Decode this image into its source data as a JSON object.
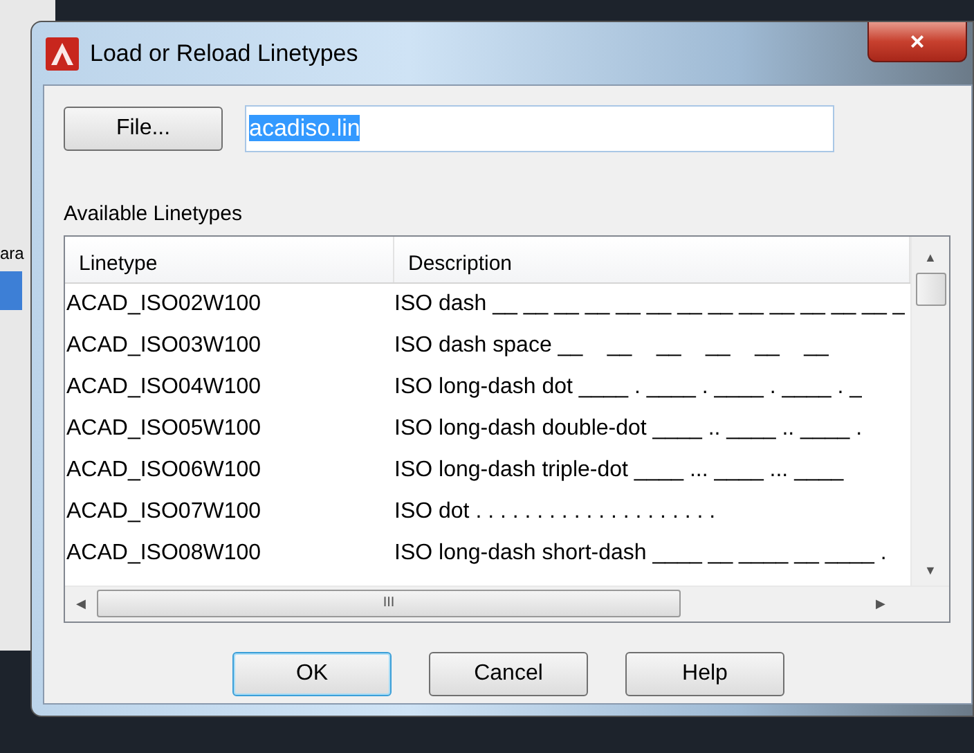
{
  "background": {
    "fragment": "ara"
  },
  "window": {
    "title": "Load or Reload Linetypes",
    "close": "×"
  },
  "file_button": "File...",
  "file_field": {
    "value": "acadiso.lin",
    "text_selected": true
  },
  "list_label": "Available Linetypes",
  "table": {
    "columns": [
      "Linetype",
      "Description"
    ],
    "rows": [
      {
        "linetype": "ACAD_ISO02W100",
        "description": "ISO dash __ __ __ __ __ __ __ __ __ __ __ __ __ _"
      },
      {
        "linetype": "ACAD_ISO03W100",
        "description": "ISO dash space __    __    __    __    __    __"
      },
      {
        "linetype": "ACAD_ISO04W100",
        "description": "ISO long-dash dot ____ . ____ . ____ . ____ . _"
      },
      {
        "linetype": "ACAD_ISO05W100",
        "description": "ISO long-dash double-dot ____ .. ____ .. ____ ."
      },
      {
        "linetype": "ACAD_ISO06W100",
        "description": "ISO long-dash triple-dot ____ ... ____ ... ____"
      },
      {
        "linetype": "ACAD_ISO07W100",
        "description": "ISO dot . . . . . . . . . . . . . . . . . . . ."
      },
      {
        "linetype": "ACAD_ISO08W100",
        "description": "ISO long-dash short-dash ____ __ ____ __ ____ ."
      }
    ],
    "scroll_up": "▲",
    "scroll_down": "▼",
    "scroll_left": "◀",
    "scroll_right": "▶",
    "grip": "III"
  },
  "buttons": [
    {
      "label": "OK",
      "default": true
    },
    {
      "label": "Cancel",
      "default": false
    },
    {
      "label": "Help",
      "default": false
    }
  ]
}
